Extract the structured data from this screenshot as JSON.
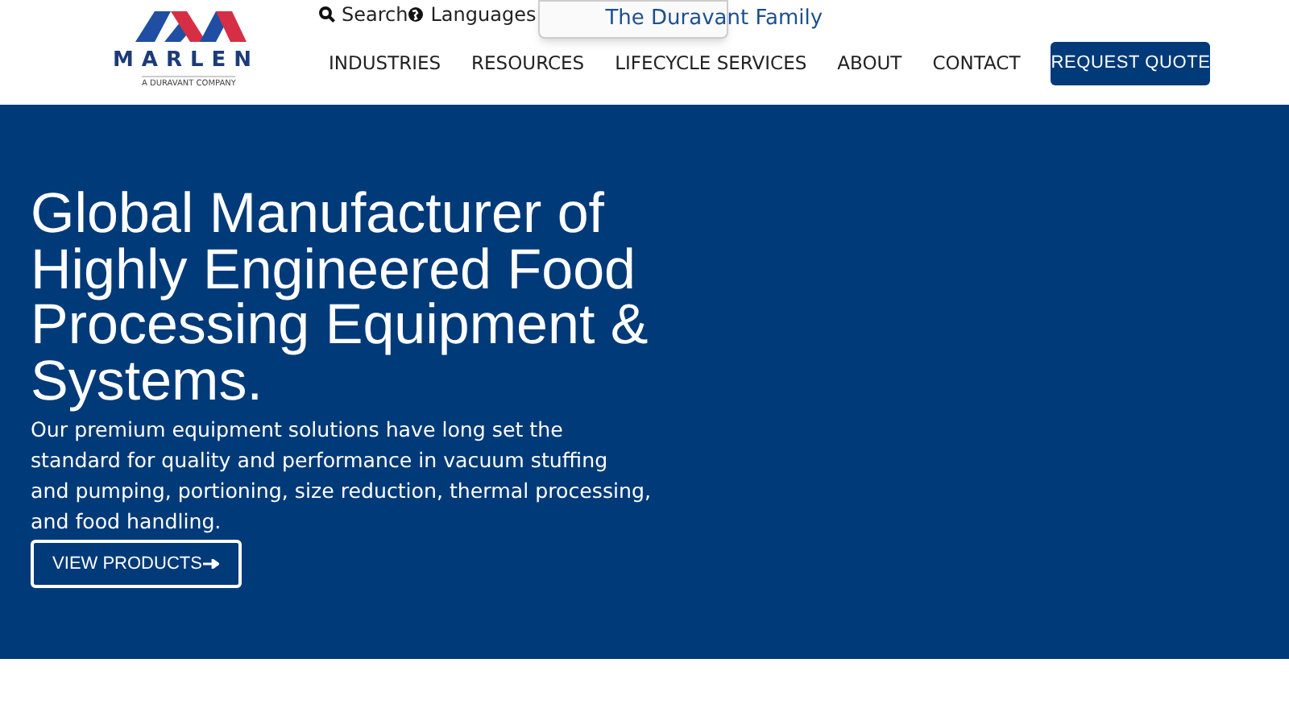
{
  "logo": {
    "wordmark": "MARLEN",
    "tagline": "A DURAVANT COMPANY"
  },
  "utility_links": [
    {
      "kind": "search",
      "label": "Search"
    },
    {
      "kind": "languages",
      "label": "Languages"
    }
  ],
  "family_tab": {
    "label": "The Duravant Family"
  },
  "nav": {
    "items": [
      "INDUSTRIES",
      "RESOURCES",
      "LIFECYCLE SERVICES",
      "ABOUT",
      "CONTACT"
    ],
    "cta": "REQUEST QUOTE"
  },
  "hero": {
    "heading": "Global Manufacturer of Highly Engineered Food Processing Equipment & Systems.",
    "text": "Our premium equipment solutions have long set the standard for quality and performance in vacuum stuffing and pumping, portioning, size reduction, thermal processing, and food handling.",
    "button": "VIEW PRODUCTS"
  }
}
